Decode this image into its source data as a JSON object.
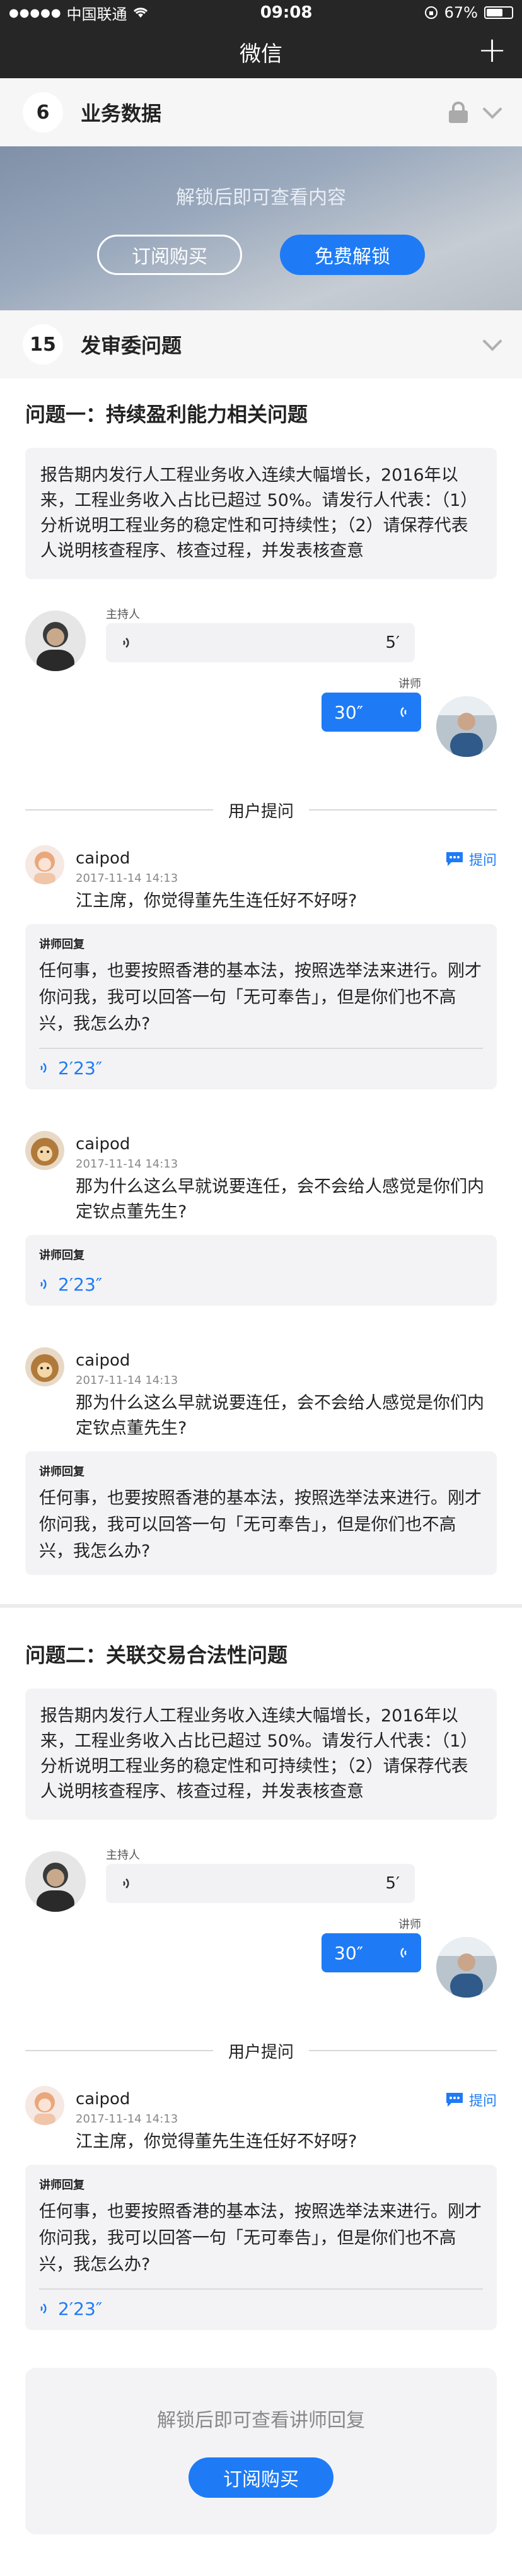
{
  "status": {
    "carrier": "中国联通",
    "time": "09:08",
    "battery": "67%",
    "battery_level": 0.67
  },
  "nav": {
    "title": "微信",
    "plus_icon": "plus-icon"
  },
  "section_business": {
    "count": "6",
    "title": "业务数据"
  },
  "locked": {
    "message": "解锁后即可查看内容",
    "subscribe_label": "订阅购买",
    "free_unlock_label": "免费解锁"
  },
  "section_review": {
    "count": "15",
    "title": "发审委问题"
  },
  "questions": [
    {
      "title": "问题一：持续盈利能力相关问题",
      "body": "报告期内发行人工程业务收入连续大幅增长，2016年以来，工程业务收入占比已超过 50%。请发行人代表：（1）分析说明工程业务的稳定性和可持续性；（2）请保荐代表人说明核查程序、核查过程，并发表核查意",
      "host_label": "主持人",
      "host_duration": "5′",
      "lecturer_label": "讲师",
      "lecturer_duration": "30″",
      "divider_label": "用户提问",
      "comments": [
        {
          "user": "caipod",
          "time": "2017-11-14 14:13",
          "text": "江主席，你觉得董先生连任好不好呀?",
          "ask_label": "提问",
          "reply_label": "讲师回复",
          "reply_text": "任何事，也要按照香港的基本法，按照选举法来进行。刚才你问我，我可以回答一句「无可奉告」，但是你们也不高兴，我怎么办?",
          "reply_audio": "2′23″"
        },
        {
          "user": "caipod",
          "time": "2017-11-14 14:13",
          "text": "那为什么这么早就说要连任，会不会给人感觉是你们内定钦点董先生?",
          "reply_label": "讲师回复",
          "reply_audio": "2′23″"
        },
        {
          "user": "caipod",
          "time": "2017-11-14 14:13",
          "text": "那为什么这么早就说要连任，会不会给人感觉是你们内定钦点董先生?",
          "reply_label": "讲师回复",
          "reply_text": "任何事，也要按照香港的基本法，按照选举法来进行。刚才你问我，我可以回答一句「无可奉告」，但是你们也不高兴，我怎么办?"
        }
      ]
    },
    {
      "title": "问题二：关联交易合法性问题",
      "body": "报告期内发行人工程业务收入连续大幅增长，2016年以来，工程业务收入占比已超过 50%。请发行人代表：（1）分析说明工程业务的稳定性和可持续性；（2）请保荐代表人说明核查程序、核查过程，并发表核查意",
      "host_label": "主持人",
      "host_duration": "5′",
      "lecturer_label": "讲师",
      "lecturer_duration": "30″",
      "divider_label": "用户提问",
      "comments": [
        {
          "user": "caipod",
          "time": "2017-11-14 14:13",
          "text": "江主席，你觉得董先生连任好不好呀?",
          "ask_label": "提问",
          "reply_label": "讲师回复",
          "reply_text": "任何事，也要按照香港的基本法，按照选举法来进行。刚才你问我，我可以回答一句「无可奉告」，但是你们也不高兴，我怎么办?",
          "reply_audio": "2′23″"
        }
      ]
    }
  ],
  "unlock_card": {
    "message": "解锁后即可查看讲师回复",
    "subscribe_label": "订阅购买"
  },
  "colors": {
    "accent": "#1e7bf5",
    "navbar": "#262626",
    "card": "#f3f3f5"
  }
}
